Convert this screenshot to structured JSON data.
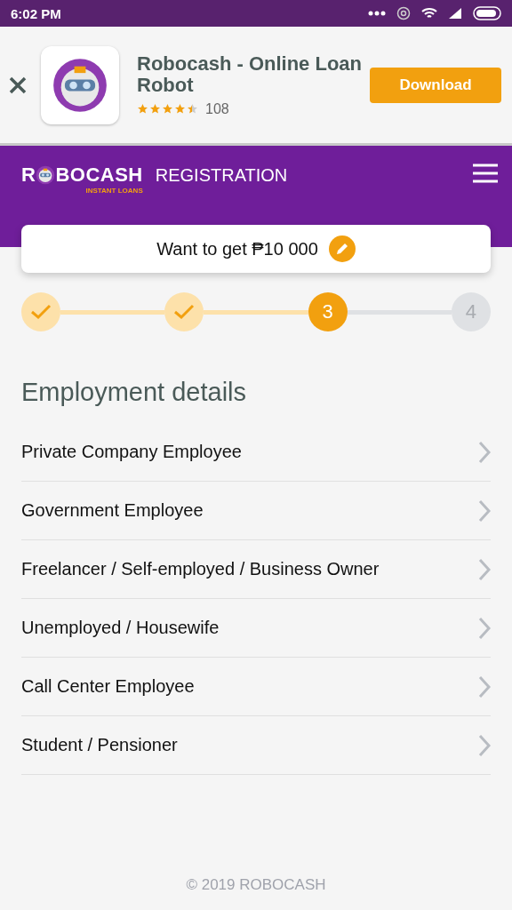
{
  "status_bar": {
    "time": "6:02 PM"
  },
  "ad": {
    "title": "Robocash - Online Loan Robot",
    "stars": 4.5,
    "rating_count": "108",
    "button": "Download"
  },
  "header": {
    "logo_start": "R",
    "logo_end": "BOCASH",
    "logo_tagline": "INSTANT LOANS",
    "title": "REGISTRATION"
  },
  "amount_card": {
    "text": "Want to get ₱10 000"
  },
  "steps": [
    {
      "kind": "done"
    },
    {
      "kind": "done"
    },
    {
      "kind": "current",
      "label": "3"
    },
    {
      "kind": "pending",
      "label": "4"
    }
  ],
  "section_title": "Employment details",
  "options": [
    "Private Company Employee",
    "Government Employee",
    "Freelancer / Self-employed / Business Owner",
    "Unemployed / Housewife",
    "Call Center Employee",
    "Student / Pensioner"
  ],
  "footer": "© 2019 ROBOCASH"
}
